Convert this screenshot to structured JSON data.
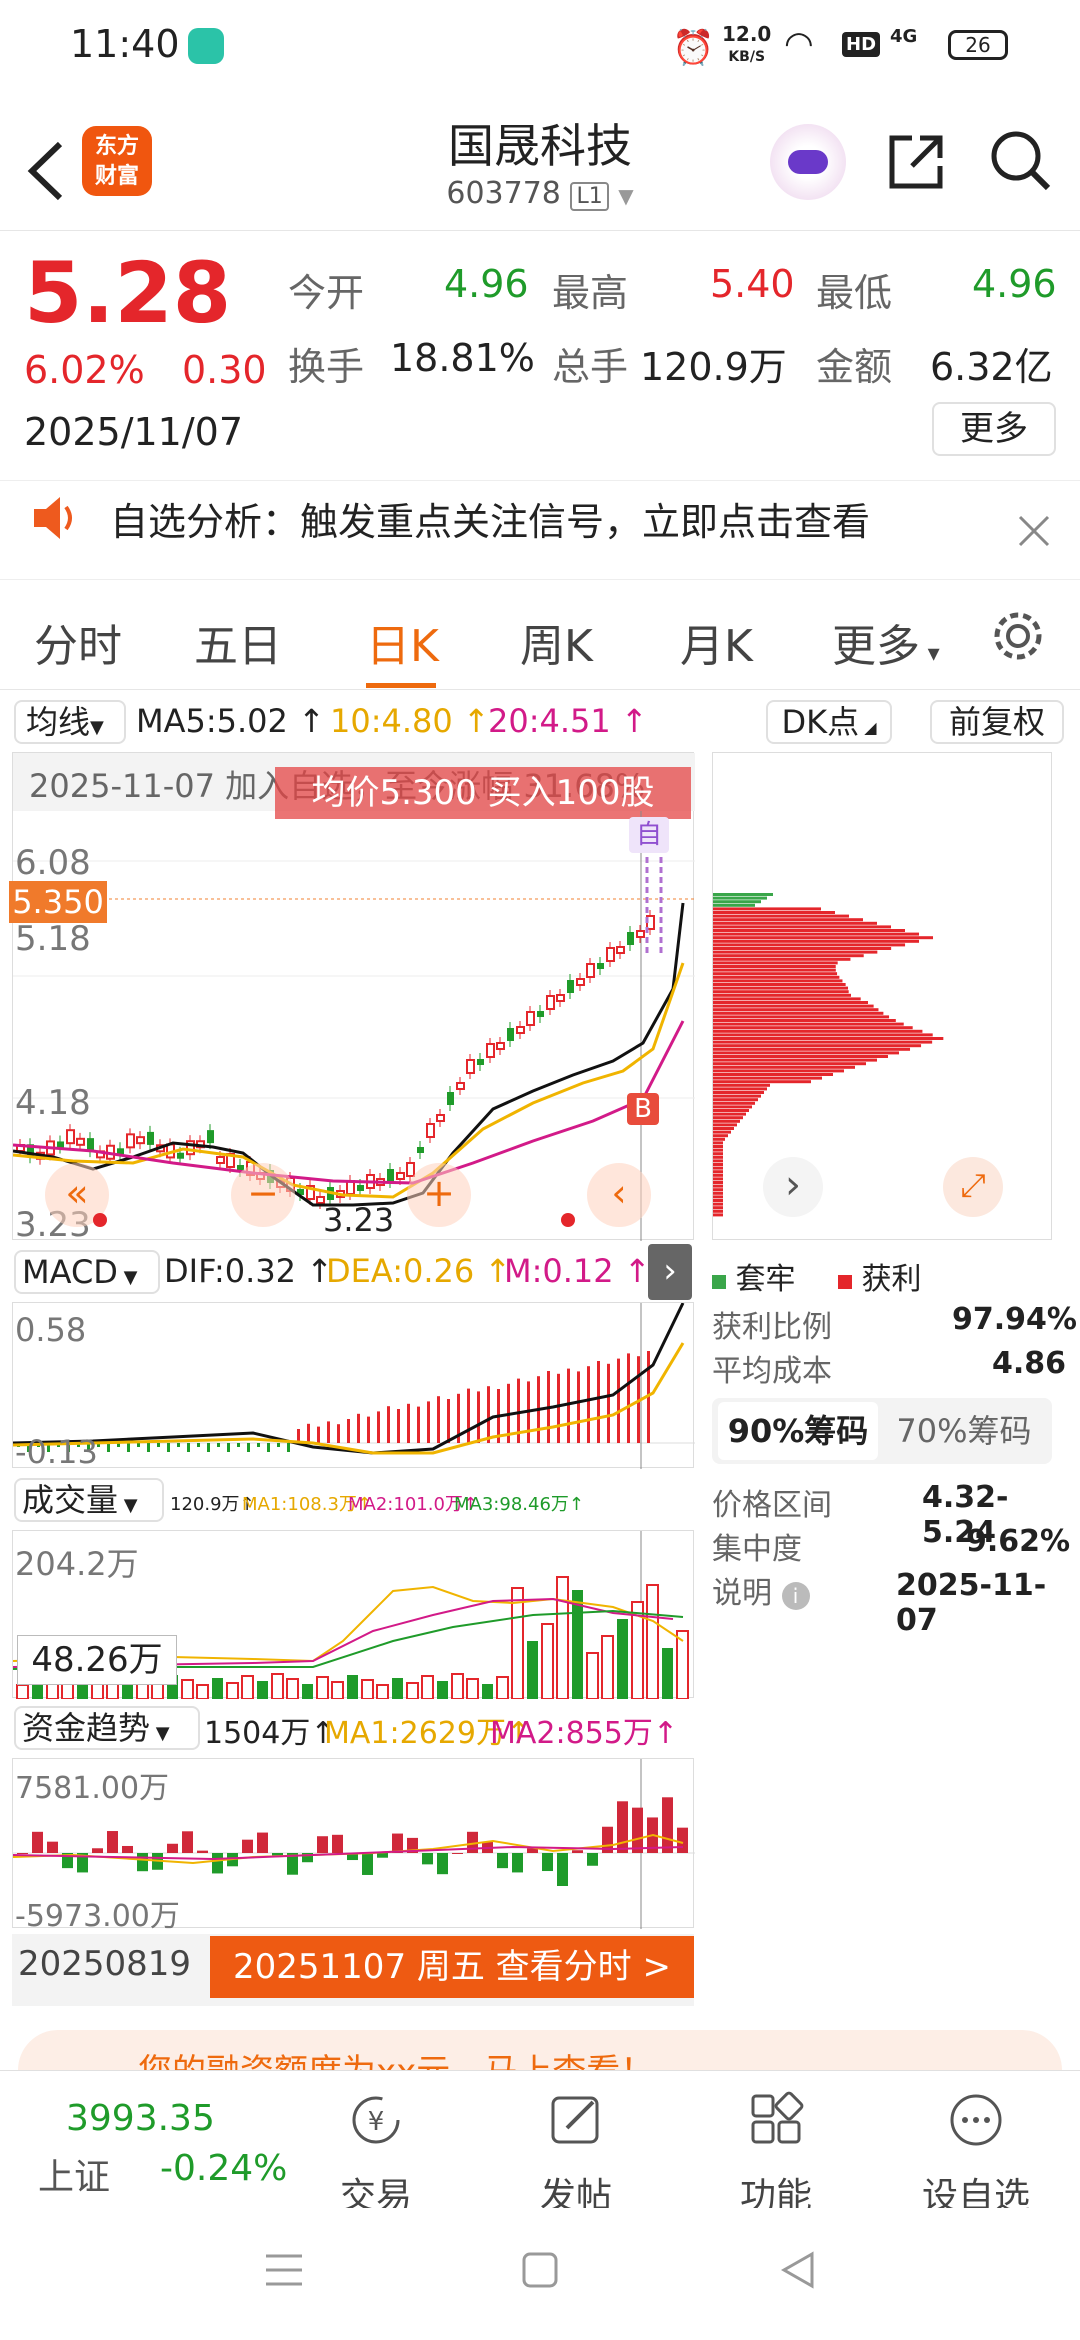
{
  "status_bar": {
    "time": "11:40",
    "net_speed_top": "12.0",
    "net_speed_bottom": "KB/S",
    "battery": "26",
    "signal_label": "4G",
    "hd_label": "HD"
  },
  "header": {
    "logo_line1": "东方",
    "logo_line2": "财富",
    "title": "国晟科技",
    "code": "603778",
    "level": "L1"
  },
  "quote": {
    "price": "5.28",
    "change_pct": "6.02%",
    "change_abs": "0.30",
    "date": "2025/11/07",
    "open_label": "今开",
    "open": "4.96",
    "high_label": "最高",
    "high": "5.40",
    "low_label": "最低",
    "low": "4.96",
    "turnover_label": "换手",
    "turnover": "18.81%",
    "volume_label": "总手",
    "volume": "120.9万",
    "amount_label": "金额",
    "amount": "6.32亿",
    "more": "更多"
  },
  "notice": {
    "text": "自选分析：触发重点关注信号，立即点击查看"
  },
  "tabs": [
    "分时",
    "五日",
    "日K",
    "周K",
    "月K",
    "更多"
  ],
  "kline": {
    "ma_label": "均线",
    "ma5": "MA5:5.02",
    "ma10": "10:4.80",
    "ma20": "20:4.51",
    "dk_btn": "DK点",
    "fq_btn": "前复权",
    "banner": "2025-11-07 加入自选，至今涨幅 31.68%",
    "buy_overlay": "均价5.300 买入100股",
    "y_top": "6.08",
    "y_mid": "5.18",
    "y_low": "4.18",
    "y_bottom": "3.23",
    "price_tag": "5.350",
    "low_mark": "3.23",
    "marker_b": "B",
    "marker_self": "自"
  },
  "macd": {
    "label": "MACD",
    "dif": "DIF:0.32",
    "dea": "DEA:0.26",
    "m": "M:0.12",
    "y_top": "0.58",
    "y_bottom": "-0.13"
  },
  "vol": {
    "label": "成交量",
    "v": "120.9万",
    "ma1": "MA1:108.3万",
    "ma2": "MA2:101.0万",
    "ma3": "MA3:98.46万",
    "y_top": "204.2万",
    "cursor_val": "48.26万"
  },
  "fund": {
    "label": "资金趋势",
    "v": "1504万",
    "ma1": "MA1:2629万",
    "ma2": "MA2:855万",
    "y_top": "7581.00万",
    "y_bottom": "-5973.00万"
  },
  "bottom": {
    "left_date": "20250819",
    "cta": "20251107 周五 查看分时 >",
    "promo": "您的融资额度为xx元，马上查看！"
  },
  "chips": {
    "legend_trapped": "套牢",
    "legend_profit": "获利",
    "profit_ratio_label": "获利比例",
    "profit_ratio": "97.94%",
    "avg_cost_label": "平均成本",
    "avg_cost": "4.86",
    "tab90": "90%筹码",
    "tab70": "70%筹码",
    "range_label": "价格区间",
    "range": "4.32-5.24",
    "concentration_label": "集中度",
    "concentration": "9.62%",
    "note_label": "说明",
    "note": "2025-11-07"
  },
  "nav": {
    "index_value": "3993.35",
    "index_name": "上证",
    "index_change": "-0.24%",
    "trade": "交易",
    "post": "发帖",
    "func": "功能",
    "watch": "设自选"
  }
}
